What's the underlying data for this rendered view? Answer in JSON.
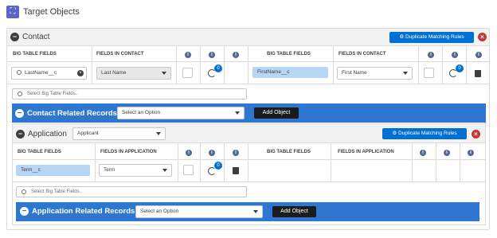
{
  "page": {
    "title": "Target Objects"
  },
  "contact": {
    "title": "Contact",
    "dup_button": "Duplicate Matching Rules",
    "headers": {
      "big_left": "BIG TABLE FIELDS",
      "fields_left": "FIELDS IN CONTACT",
      "big_right": "BIG TABLE FIELDS",
      "fields_right": "FIELDS IN CONTACT"
    },
    "row": {
      "big_left_value": "LastName__c",
      "field_left": "Last Name",
      "badge_left": "0",
      "big_right_value": "FirstName__c",
      "field_right": "First Name",
      "badge_right": "0"
    },
    "search_placeholder": "Select Big Table Fields..",
    "related": {
      "title": "Contact Related Records",
      "select_placeholder": "Select an Option",
      "add_label": "Add Object"
    }
  },
  "application": {
    "title": "Application",
    "type_select": "Applicant",
    "dup_button": "Duplicate Matching Rules",
    "headers": {
      "big_left": "BIG TABLE FIELDS",
      "fields_left": "FIELDS IN APPLICATION",
      "big_right": "BIG TABLE FIELDS",
      "fields_right": "FIELDS IN APPLICATION"
    },
    "row": {
      "big_left_value": "Term__c",
      "field_left": "Term",
      "badge_left": "0"
    },
    "search_placeholder": "Select Big Table Fields..",
    "related": {
      "title": "Application Related Records",
      "select_placeholder": "Select an Option",
      "add_label": "Add Object"
    }
  },
  "icons": {
    "info": "i",
    "close": "×",
    "minus": "−",
    "header": "target-objects-icon"
  },
  "colors": {
    "brand_blue": "#0070d2",
    "bar_blue": "#2e77d0",
    "close_red": "#c23934",
    "pill_blue": "#b7d5f4"
  }
}
